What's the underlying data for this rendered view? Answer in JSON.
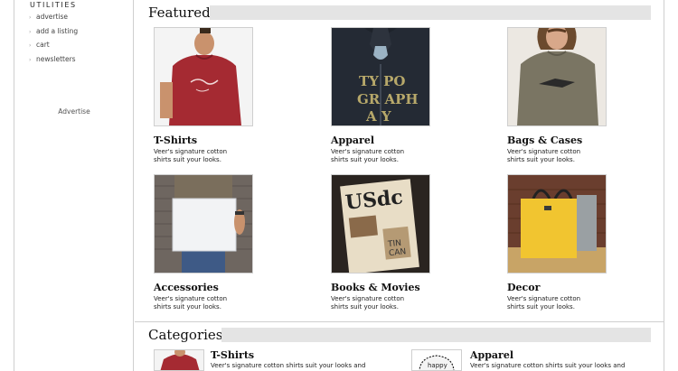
{
  "sidebar": {
    "heading": "UTILITIES",
    "links": [
      "advertise",
      "add a listing",
      "cart",
      "newsletters"
    ],
    "advertise_label": "Advertise"
  },
  "featured": {
    "title": "Featured",
    "items": [
      {
        "title": "T-Shirts",
        "desc": "Veer's signature cotton shirts suit your looks.",
        "image": "man-in-red-tshirt"
      },
      {
        "title": "Apparel",
        "desc": "Veer's signature cotton shirts suit your looks.",
        "image": "typography-hoodie"
      },
      {
        "title": "Bags & Cases",
        "desc": "Veer's signature cotton shirts suit your looks.",
        "image": "woman-in-olive-tshirt"
      },
      {
        "title": "Accessories",
        "desc": "Veer's signature cotton shirts suit your looks.",
        "image": "laptop-sleeve"
      },
      {
        "title": "Books & Movies",
        "desc": "Veer's signature cotton shirts suit your looks.",
        "image": "usdc-book"
      },
      {
        "title": "Decor",
        "desc": "Veer's signature cotton shirts suit your looks.",
        "image": "yellow-tote-bag"
      }
    ]
  },
  "categories": {
    "title": "Categories",
    "items": [
      {
        "title": "T-Shirts",
        "desc": "Veer's signature cotton shirts suit your looks and",
        "image": "man-in-red-tshirt"
      },
      {
        "title": "Apparel",
        "desc": "Veer's signature cotton shirts suit your looks and",
        "image": "happy-badge-graphic"
      }
    ]
  },
  "colors": {
    "border": "#cfcfcf",
    "section_bar": "#e4e4e4",
    "red_shirt": "#a52a32"
  }
}
